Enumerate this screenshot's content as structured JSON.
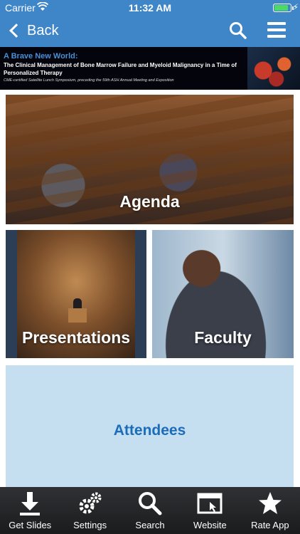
{
  "status_bar": {
    "carrier": "Carrier",
    "time": "11:32 AM",
    "battery_level": 0.9
  },
  "nav": {
    "back_label": "Back"
  },
  "banner": {
    "title": "A Brave New World:",
    "subtitle": "The Clinical Management of Bone Marrow Failure and Myeloid Malignancy in a Time of Personalized Therapy",
    "note": "CME-certified Satellite Lunch Symposium, preceding the 59th ASH Annual Meeting and Exposition"
  },
  "tiles": {
    "agenda": "Agenda",
    "presentations": "Presentations",
    "faculty": "Faculty",
    "attendees": "Attendees"
  },
  "toolbar": [
    {
      "label": "Get Slides",
      "icon": "download-icon"
    },
    {
      "label": "Settings",
      "icon": "gear-icon"
    },
    {
      "label": "Search",
      "icon": "search-icon"
    },
    {
      "label": "Website",
      "icon": "browser-icon"
    },
    {
      "label": "Rate App",
      "icon": "star-icon"
    }
  ],
  "colors": {
    "nav_bar": "#3f86c8",
    "attendees_tile": "#c6dff0",
    "attendees_text": "#1b6db8",
    "toolbar": "#2f3134"
  }
}
